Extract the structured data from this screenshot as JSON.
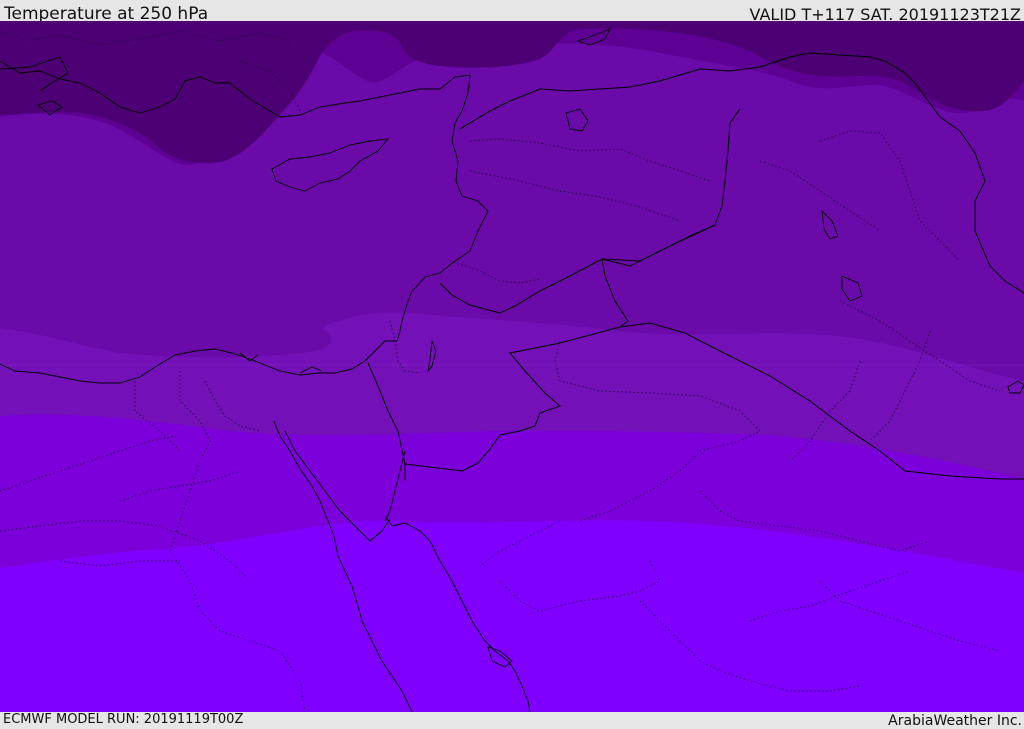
{
  "header": {
    "title": "Temperature at 250 hPa",
    "valid": "VALID T+117 SAT. 20191123T21Z"
  },
  "footer": {
    "model_run": "ECMWF MODEL RUN: 20191119T00Z",
    "brand": "ArabiaWeather Inc."
  },
  "map": {
    "colors": {
      "coldest": "#4d0073",
      "cold": "#5f0095",
      "mid": "#6a0aa8",
      "band3": "#7310b8",
      "band4": "#7b00d9",
      "warm": "#7f00ff"
    }
  }
}
